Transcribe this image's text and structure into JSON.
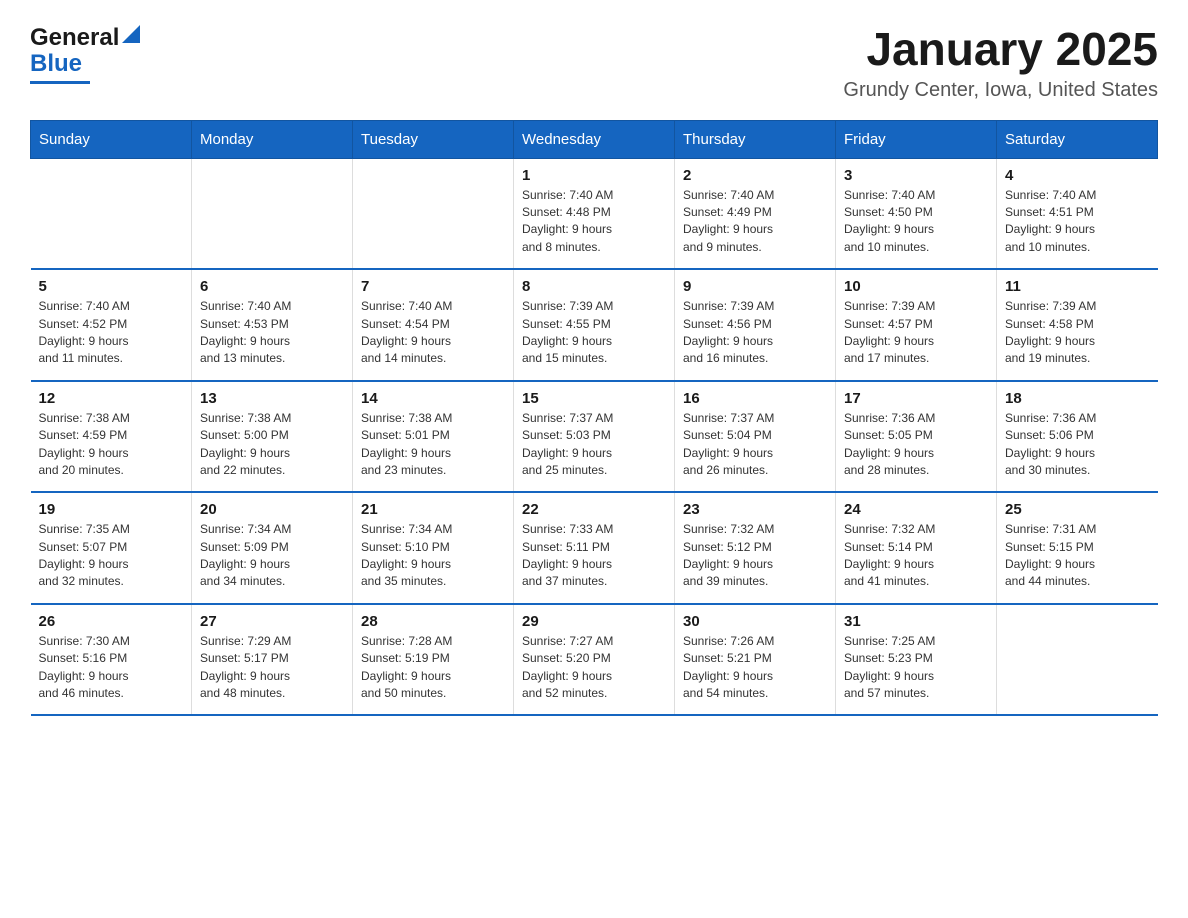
{
  "logo": {
    "general": "General",
    "blue": "Blue"
  },
  "header": {
    "title": "January 2025",
    "subtitle": "Grundy Center, Iowa, United States"
  },
  "weekdays": [
    "Sunday",
    "Monday",
    "Tuesday",
    "Wednesday",
    "Thursday",
    "Friday",
    "Saturday"
  ],
  "weeks": [
    [
      {
        "day": "",
        "info": ""
      },
      {
        "day": "",
        "info": ""
      },
      {
        "day": "",
        "info": ""
      },
      {
        "day": "1",
        "info": "Sunrise: 7:40 AM\nSunset: 4:48 PM\nDaylight: 9 hours\nand 8 minutes."
      },
      {
        "day": "2",
        "info": "Sunrise: 7:40 AM\nSunset: 4:49 PM\nDaylight: 9 hours\nand 9 minutes."
      },
      {
        "day": "3",
        "info": "Sunrise: 7:40 AM\nSunset: 4:50 PM\nDaylight: 9 hours\nand 10 minutes."
      },
      {
        "day": "4",
        "info": "Sunrise: 7:40 AM\nSunset: 4:51 PM\nDaylight: 9 hours\nand 10 minutes."
      }
    ],
    [
      {
        "day": "5",
        "info": "Sunrise: 7:40 AM\nSunset: 4:52 PM\nDaylight: 9 hours\nand 11 minutes."
      },
      {
        "day": "6",
        "info": "Sunrise: 7:40 AM\nSunset: 4:53 PM\nDaylight: 9 hours\nand 13 minutes."
      },
      {
        "day": "7",
        "info": "Sunrise: 7:40 AM\nSunset: 4:54 PM\nDaylight: 9 hours\nand 14 minutes."
      },
      {
        "day": "8",
        "info": "Sunrise: 7:39 AM\nSunset: 4:55 PM\nDaylight: 9 hours\nand 15 minutes."
      },
      {
        "day": "9",
        "info": "Sunrise: 7:39 AM\nSunset: 4:56 PM\nDaylight: 9 hours\nand 16 minutes."
      },
      {
        "day": "10",
        "info": "Sunrise: 7:39 AM\nSunset: 4:57 PM\nDaylight: 9 hours\nand 17 minutes."
      },
      {
        "day": "11",
        "info": "Sunrise: 7:39 AM\nSunset: 4:58 PM\nDaylight: 9 hours\nand 19 minutes."
      }
    ],
    [
      {
        "day": "12",
        "info": "Sunrise: 7:38 AM\nSunset: 4:59 PM\nDaylight: 9 hours\nand 20 minutes."
      },
      {
        "day": "13",
        "info": "Sunrise: 7:38 AM\nSunset: 5:00 PM\nDaylight: 9 hours\nand 22 minutes."
      },
      {
        "day": "14",
        "info": "Sunrise: 7:38 AM\nSunset: 5:01 PM\nDaylight: 9 hours\nand 23 minutes."
      },
      {
        "day": "15",
        "info": "Sunrise: 7:37 AM\nSunset: 5:03 PM\nDaylight: 9 hours\nand 25 minutes."
      },
      {
        "day": "16",
        "info": "Sunrise: 7:37 AM\nSunset: 5:04 PM\nDaylight: 9 hours\nand 26 minutes."
      },
      {
        "day": "17",
        "info": "Sunrise: 7:36 AM\nSunset: 5:05 PM\nDaylight: 9 hours\nand 28 minutes."
      },
      {
        "day": "18",
        "info": "Sunrise: 7:36 AM\nSunset: 5:06 PM\nDaylight: 9 hours\nand 30 minutes."
      }
    ],
    [
      {
        "day": "19",
        "info": "Sunrise: 7:35 AM\nSunset: 5:07 PM\nDaylight: 9 hours\nand 32 minutes."
      },
      {
        "day": "20",
        "info": "Sunrise: 7:34 AM\nSunset: 5:09 PM\nDaylight: 9 hours\nand 34 minutes."
      },
      {
        "day": "21",
        "info": "Sunrise: 7:34 AM\nSunset: 5:10 PM\nDaylight: 9 hours\nand 35 minutes."
      },
      {
        "day": "22",
        "info": "Sunrise: 7:33 AM\nSunset: 5:11 PM\nDaylight: 9 hours\nand 37 minutes."
      },
      {
        "day": "23",
        "info": "Sunrise: 7:32 AM\nSunset: 5:12 PM\nDaylight: 9 hours\nand 39 minutes."
      },
      {
        "day": "24",
        "info": "Sunrise: 7:32 AM\nSunset: 5:14 PM\nDaylight: 9 hours\nand 41 minutes."
      },
      {
        "day": "25",
        "info": "Sunrise: 7:31 AM\nSunset: 5:15 PM\nDaylight: 9 hours\nand 44 minutes."
      }
    ],
    [
      {
        "day": "26",
        "info": "Sunrise: 7:30 AM\nSunset: 5:16 PM\nDaylight: 9 hours\nand 46 minutes."
      },
      {
        "day": "27",
        "info": "Sunrise: 7:29 AM\nSunset: 5:17 PM\nDaylight: 9 hours\nand 48 minutes."
      },
      {
        "day": "28",
        "info": "Sunrise: 7:28 AM\nSunset: 5:19 PM\nDaylight: 9 hours\nand 50 minutes."
      },
      {
        "day": "29",
        "info": "Sunrise: 7:27 AM\nSunset: 5:20 PM\nDaylight: 9 hours\nand 52 minutes."
      },
      {
        "day": "30",
        "info": "Sunrise: 7:26 AM\nSunset: 5:21 PM\nDaylight: 9 hours\nand 54 minutes."
      },
      {
        "day": "31",
        "info": "Sunrise: 7:25 AM\nSunset: 5:23 PM\nDaylight: 9 hours\nand 57 minutes."
      },
      {
        "day": "",
        "info": ""
      }
    ]
  ]
}
